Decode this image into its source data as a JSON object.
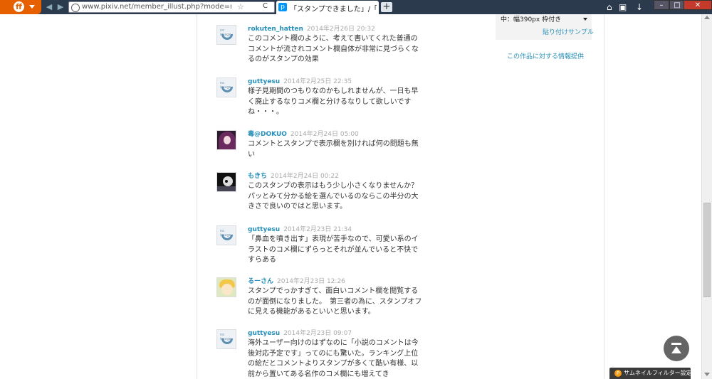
{
  "browser": {
    "url": "www.pixiv.net/member_illust.php?mode=n",
    "tab_title": "「スタンプできました」/「pi...",
    "new_tab": "+",
    "favicon": "p",
    "menu_logo": "ff"
  },
  "sidebar": {
    "size_select": "中：幅390px 枠付き",
    "paste_sample_link": "貼り付けサンプル",
    "report_link": "この作品に対する情報提供"
  },
  "comments": [
    {
      "user": "rokuten_hatten",
      "date": "2014年2月26日 20:32",
      "avatar": "default",
      "text": "このコメント欄のように、考えて書いてくれた普通のコメントが流されコメント欄自体が非常に見づらくなるのがスタンプの効果"
    },
    {
      "user": "guttyesu",
      "date": "2014年2月25日 22:35",
      "avatar": "default",
      "text": "様子見期間のつもりなのかもしれませんが、一日も早く廃止するなりコメ欄と分けるなりして欲しいですね・・・。"
    },
    {
      "user": "毒@DOKUO",
      "date": "2014年2月24日 05:00",
      "avatar": "dark",
      "text": "コメントとスタンプで表示欄を別ければ何の問題も無い"
    },
    {
      "user": "もきち",
      "date": "2014年2月24日 00:22",
      "avatar": "bw",
      "text": "このスタンプの表示はもう少し小さくなりませんか？パッとみて分かる絵を選んでいるのならこの半分の大きさで良いのではと思います。"
    },
    {
      "user": "guttyesu",
      "date": "2014年2月23日 21:34",
      "avatar": "default",
      "text": "「鼻血を噴き出す」表現が苦手なので、可愛い系のイラストのコメ欄にずらっとそれが並んでいると不快ですらある"
    },
    {
      "user": "るーさん",
      "date": "2014年2月23日 12:26",
      "avatar": "yellow",
      "text": "スタンプでっかすぎて、面白いコメント欄を閲覧するのが面倒になりました。　第三者の為に、スタンプオフに見える機能があるといいと思います。"
    },
    {
      "user": "guttyesu",
      "date": "2014年2月23日 09:07",
      "avatar": "default",
      "text": "海外ユーザー向けのはずなのに「小説のコメントは今後対応予定です」ってのにも驚いた。ランキング上位の絵だとコメントよりスタンプが多くて酷い有様、以前から置いてある名作のコメ欄にも増えてき"
    }
  ],
  "default_avatar_label": "no image",
  "thumbnail_filter": "サムネイルフィルター設定",
  "filter_icon": "P"
}
